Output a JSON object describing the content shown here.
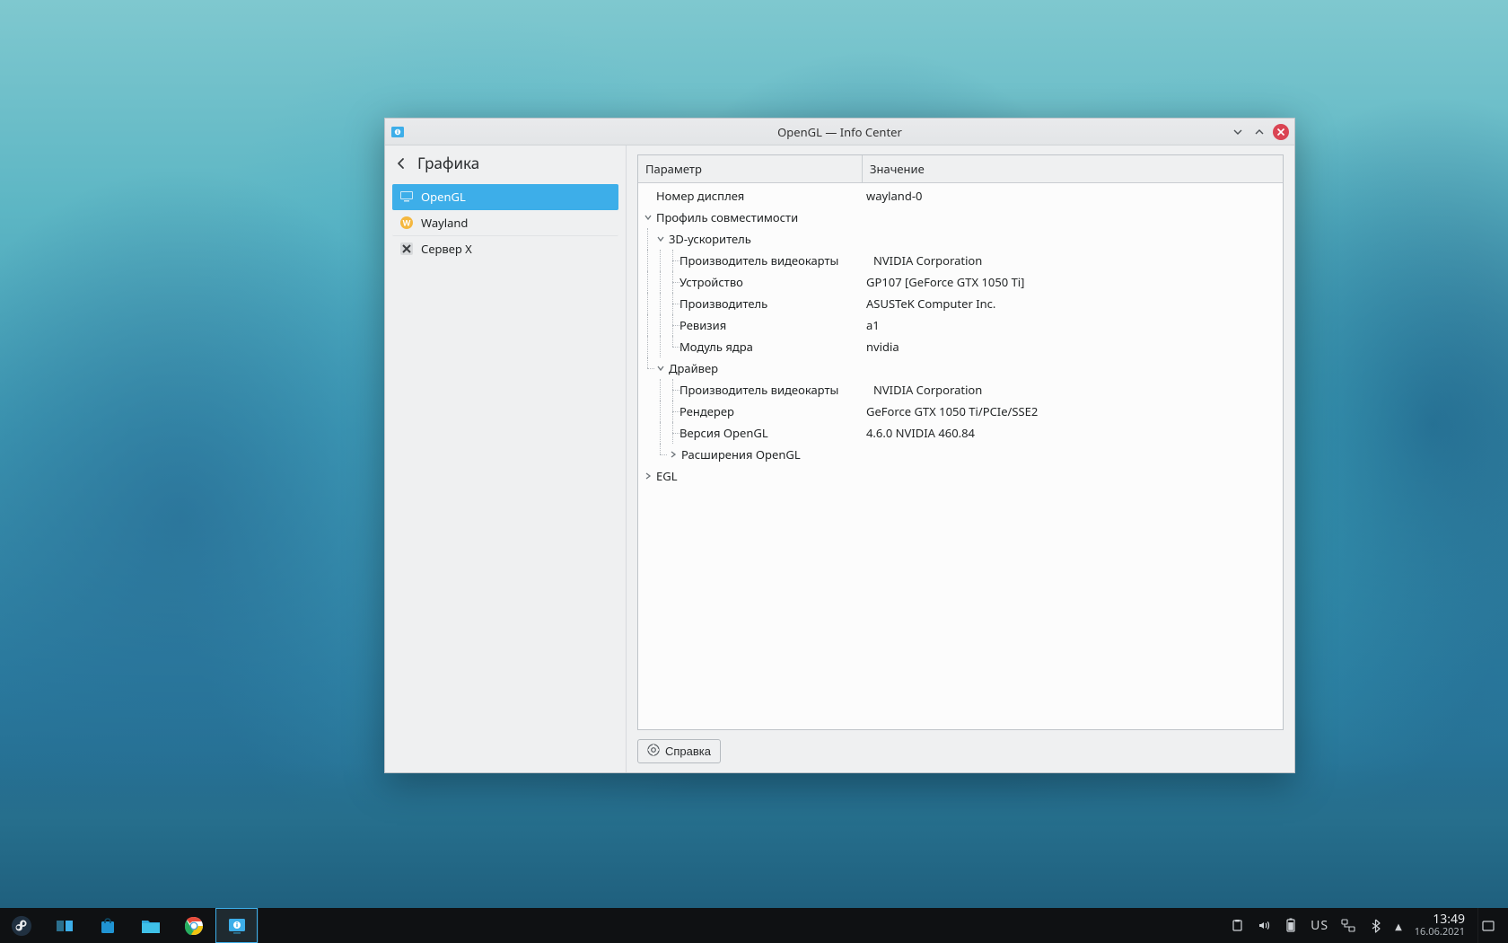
{
  "window": {
    "title": "OpenGL — Info Center"
  },
  "sidebar": {
    "header": "Графика",
    "items": [
      {
        "label": "OpenGL",
        "selected": true
      },
      {
        "label": "Wayland",
        "selected": false
      },
      {
        "label": "Сервер X",
        "selected": false
      }
    ]
  },
  "columns": {
    "param": "Параметр",
    "value": "Значение"
  },
  "tree": {
    "display_number": {
      "label": "Номер дисплея",
      "value": "wayland-0"
    },
    "profile": {
      "label": "Профиль совместимости"
    },
    "accel": {
      "label": "3D-ускоритель"
    },
    "gpu_vendor": {
      "label": "Производитель видеокарты",
      "value": "NVIDIA Corporation"
    },
    "device": {
      "label": "Устройство",
      "value": "GP107 [GeForce GTX 1050 Ti]"
    },
    "manufacturer": {
      "label": "Производитель",
      "value": "ASUSTeK Computer Inc."
    },
    "revision": {
      "label": "Ревизия",
      "value": "a1"
    },
    "kmod": {
      "label": "Модуль ядра",
      "value": "nvidia"
    },
    "driver": {
      "label": "Драйвер"
    },
    "drv_vendor": {
      "label": "Производитель видеокарты",
      "value": "NVIDIA Corporation"
    },
    "renderer": {
      "label": "Рендерер",
      "value": "GeForce GTX 1050 Ti/PCIe/SSE2"
    },
    "gl_version": {
      "label": "Версия OpenGL",
      "value": "4.6.0 NVIDIA 460.84"
    },
    "gl_ext": {
      "label": "Расширения OpenGL"
    },
    "egl": {
      "label": "EGL"
    }
  },
  "buttons": {
    "help": "Справка"
  },
  "taskbar": {
    "keyboard": "US",
    "time": "13:49",
    "date": "16.06.2021"
  }
}
